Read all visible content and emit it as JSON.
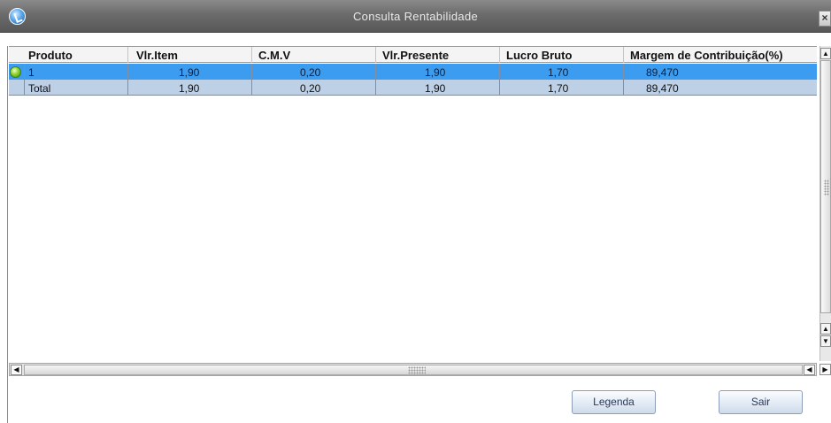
{
  "window": {
    "title": "Consulta Rentabilidade",
    "close_glyph": "×",
    "app_icon": "app-logo-icon"
  },
  "grid": {
    "columns": [
      "Produto",
      "Vlr.Item",
      "C.M.V",
      "Vlr.Presente",
      "Lucro Bruto",
      "Margem de Contribuição(%)"
    ],
    "rows": [
      {
        "status_icon": "green-status-icon",
        "selected": true,
        "cells": [
          "1",
          "1,90",
          "0,20",
          "1,90",
          "1,70",
          "89,470"
        ]
      },
      {
        "selected": false,
        "cells": [
          "Total",
          "1,90",
          "0,20",
          "1,90",
          "1,70",
          "89,470"
        ]
      }
    ]
  },
  "scrollbars": {
    "up_glyph": "▲",
    "down_glyph": "▼",
    "left_glyph": "◀",
    "right_glyph": "▶"
  },
  "buttons": {
    "legend_label": "Legenda",
    "exit_label": "Sair"
  },
  "colors": {
    "selected_row": "#3c9cf0",
    "total_row": "#bdd0e6",
    "titlebar": "#6b6b6b"
  }
}
